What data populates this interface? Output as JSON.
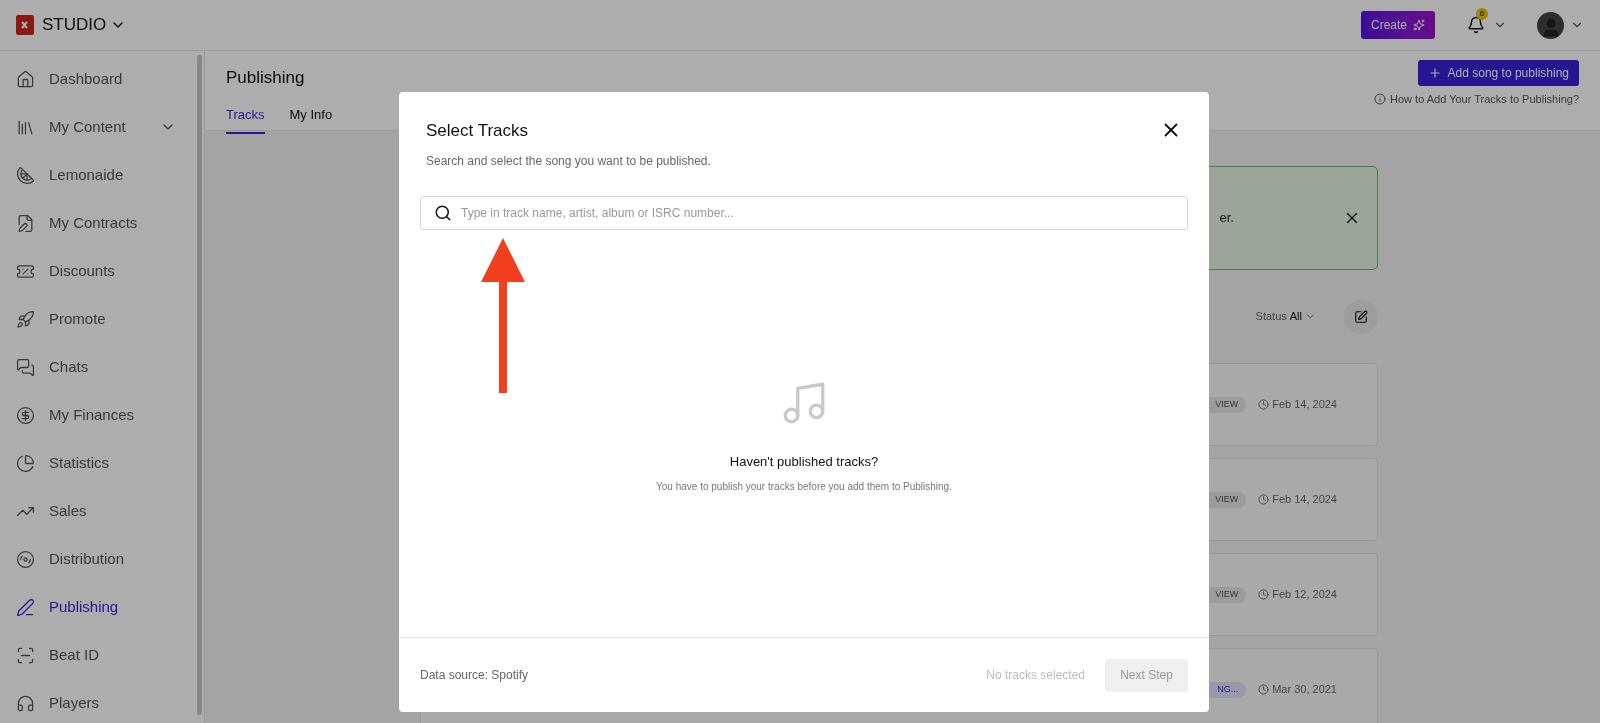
{
  "topbar": {
    "brand": "STUDIO",
    "create_button": "Create",
    "notification_count": "6"
  },
  "sidebar": {
    "items": [
      {
        "label": "Dashboard",
        "kind": "link",
        "selected": false
      },
      {
        "label": "My Content",
        "kind": "group",
        "selected": false
      },
      {
        "label": "Lemonaide",
        "kind": "link",
        "selected": false
      },
      {
        "label": "My Contracts",
        "kind": "link",
        "selected": false
      },
      {
        "label": "Discounts",
        "kind": "link",
        "selected": false
      },
      {
        "label": "Promote",
        "kind": "link",
        "selected": false
      },
      {
        "label": "Chats",
        "kind": "link",
        "selected": false
      },
      {
        "label": "My Finances",
        "kind": "link",
        "selected": false
      },
      {
        "label": "Statistics",
        "kind": "link",
        "selected": false
      },
      {
        "label": "Sales",
        "kind": "link",
        "selected": false
      },
      {
        "label": "Distribution",
        "kind": "link",
        "selected": false
      },
      {
        "label": "Publishing",
        "kind": "link",
        "selected": true
      },
      {
        "label": "Beat ID",
        "kind": "link",
        "selected": false
      },
      {
        "label": "Players",
        "kind": "link",
        "selected": false
      }
    ]
  },
  "page": {
    "title": "Publishing",
    "tabs": [
      {
        "label": "Tracks",
        "selected": true
      },
      {
        "label": "My Info",
        "selected": false
      }
    ],
    "add_button": "Add song to publishing",
    "help_link": "How to Add Your Tracks to Publishing?",
    "banner": {
      "text": "er."
    },
    "filter": {
      "label": "Status",
      "value": "All"
    },
    "rows": [
      {
        "badge": "VIEW",
        "color": "#9c9c9c",
        "date": "Feb 14, 2024"
      },
      {
        "badge": "VIEW",
        "color": "#9c9c9c",
        "date": "Feb 14, 2024"
      },
      {
        "badge": "VIEW",
        "color": "#9c9c9c",
        "date": "Feb 12, 2024"
      },
      {
        "badge": "NG...",
        "color": "#9a98ab",
        "date": "Mar 30, 2021"
      }
    ]
  },
  "modal": {
    "title": "Select Tracks",
    "subtitle": "Search and select the song you want to be published.",
    "search": {
      "placeholder": "Type in track name, artist, album or ISRC number..."
    },
    "empty": {
      "heading": "Haven't published tracks?",
      "text": "You have to publish your tracks before you add them to Publishing."
    },
    "footer": {
      "source": "Data source: Spotify",
      "selection": "No tracks selected",
      "next_button": "Next Step",
      "next_disabled": true
    }
  }
}
